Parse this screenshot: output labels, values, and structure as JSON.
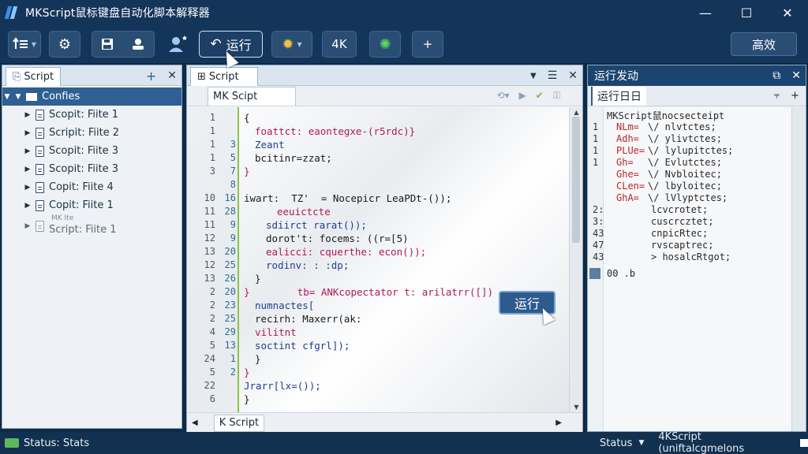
{
  "app": {
    "title": "MKScript鼠标键盘自动化脚本解释器",
    "window_controls": {
      "minimize": "—",
      "maximize": "☐",
      "close": "✕"
    }
  },
  "toolbar": {
    "run_label": "运行",
    "resolution_label": "4K",
    "right_button_label": "高效",
    "add_label": "+"
  },
  "explorer": {
    "tab_label": "Script",
    "add_icon": "+",
    "close_icon": "✕",
    "root_label": "Confies",
    "items": [
      {
        "label": "Scopit: Fiite 1"
      },
      {
        "label": "Scripit: Fiite 2"
      },
      {
        "label": "Scopit: Fiite 3"
      },
      {
        "label": "Scopit: Fiite 3"
      },
      {
        "label": "Copit: Fiite 4"
      },
      {
        "label": "Copit: Fiite 1"
      },
      {
        "label": "Script: Fiite 1",
        "overlay": "MK Ite"
      }
    ]
  },
  "editor": {
    "tab_label": "Script",
    "subtab_label": "MK Scipt",
    "footer_tab_label": "K Script",
    "run_button_label": "运行",
    "lines": [
      {
        "n1": "1",
        "n2": "",
        "text": "{",
        "indent": 0
      },
      {
        "n1": "1",
        "n2": "",
        "text": "foattct: eaontegxe-(r5rdc)}",
        "indent": 1
      },
      {
        "n1": "1",
        "n2": "3",
        "text": "Zeant",
        "indent": 1
      },
      {
        "n1": "1",
        "n2": "5",
        "text": "bcitinr=zzat;",
        "indent": 1
      },
      {
        "n1": "3",
        "n2": "7",
        "text": "}",
        "indent": 0
      },
      {
        "n1": "",
        "n2": "8",
        "text": "",
        "indent": 0
      },
      {
        "n1": "10",
        "n2": "16",
        "text": "iwart:  TZ'  = Nocepicr LeaPDt-());",
        "indent": 0
      },
      {
        "n1": "11",
        "n2": "28",
        "text": "eeuictcte",
        "indent": 3
      },
      {
        "n1": "11",
        "n2": "9",
        "text": "sdiirct rarat());",
        "indent": 2
      },
      {
        "n1": "12",
        "n2": "9",
        "text": "dorot't: focems: ((r=[5)",
        "indent": 2
      },
      {
        "n1": "13",
        "n2": "20",
        "text": "ealicci: cquerthe: econ());",
        "indent": 2
      },
      {
        "n1": "12",
        "n2": "25",
        "text": "rodinv: : :dp;",
        "indent": 2
      },
      {
        "n1": "13",
        "n2": "26",
        "text": "}",
        "indent": 1
      },
      {
        "n1": "2",
        "n2": "20",
        "text": "}        tb= ANKcopectator t: arilatrr([])",
        "indent": 0
      },
      {
        "n1": "2",
        "n2": "23",
        "text": "numnactes[",
        "indent": 1
      },
      {
        "n1": "2",
        "n2": "25",
        "text": "recirh: Maxerr(ak:",
        "indent": 1
      },
      {
        "n1": "4",
        "n2": "29",
        "text": "vilitnt",
        "indent": 1
      },
      {
        "n1": "5",
        "n2": "13",
        "text": "soctint cfgrl]);",
        "indent": 1
      },
      {
        "n1": "24",
        "n2": "1",
        "text": "}",
        "indent": 1
      },
      {
        "n1": "5",
        "n2": "2",
        "text": "}",
        "indent": 0
      },
      {
        "n1": "22",
        "n2": "",
        "text": "Jrarr[lx=());",
        "indent": 0
      },
      {
        "n1": "6",
        "n2": "",
        "text": "}",
        "indent": 0
      }
    ]
  },
  "output": {
    "title": "运行发动",
    "tab_label": "运行日日",
    "header_line": "MKScript鼠nocsecteipt",
    "rows": [
      {
        "ln": "1",
        "key": "NLm=",
        "val": "\\/ nlvtctes;"
      },
      {
        "ln": "1",
        "key": "Adh=",
        "val": "\\/ ylivtctes;"
      },
      {
        "ln": "1",
        "key": "PLUe=",
        "val": "\\/ lylupitctes;"
      },
      {
        "ln": "1",
        "key": "Gh=",
        "val": "\\/ Evlutctes;"
      },
      {
        "ln": "",
        "key": "Ghe=",
        "val": "\\/ Nvbloitec;"
      },
      {
        "ln": "",
        "key": "CLen=",
        "val": "\\/ lbyloitec;"
      },
      {
        "ln": "",
        "key": "GhA=",
        "val": "\\/ lVlyptctes;"
      },
      {
        "ln": "2:",
        "key": "",
        "val": "lcvcrotet;"
      },
      {
        "ln": "3:",
        "key": "",
        "val": "cuscrcztet;"
      },
      {
        "ln": "43",
        "key": "",
        "val": "cnpicRtec;"
      },
      {
        "ln": "47",
        "key": "",
        "val": "rvscaptrec;"
      },
      {
        "ln": "43",
        "key": "",
        "val": "> hosalcRtgot;"
      }
    ],
    "footer_line": "00 .b"
  },
  "status": {
    "left_label": "Status: Stats",
    "right_label": "Status",
    "right_text": "4KScript (uniftalcgmelons"
  }
}
